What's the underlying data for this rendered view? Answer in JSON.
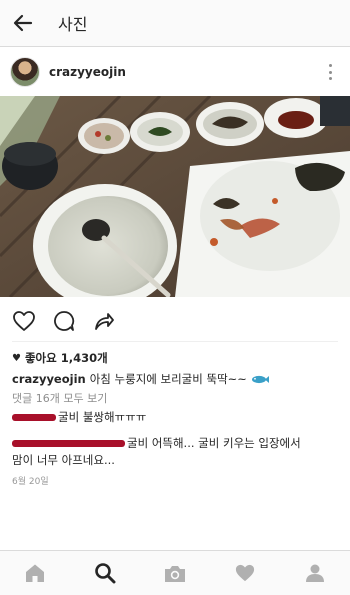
{
  "topbar": {
    "title": "사진"
  },
  "post": {
    "username": "crazyyeojin",
    "likes_text": "좋아요 1,430개",
    "caption": {
      "username": "crazyyeojin",
      "text": "아침 누룽지에 보리굴비 뚝딱~~"
    },
    "view_comments": "댓글 16개 모두 보기",
    "comments": [
      {
        "text": "굴비 불쌍해ㅠㅠㅠ"
      },
      {
        "text": "굴비 어뜩해... 굴비 키우는 입장에서",
        "text2": "맘이 너무 아프네요..."
      }
    ],
    "date": "6월 20일"
  },
  "icons": {
    "back": "arrow-left-icon",
    "more": "more-vertical-icon",
    "like": "heart-outline-icon",
    "comment": "comment-icon",
    "share": "share-arrow-icon",
    "home": "home-icon",
    "search": "search-icon",
    "camera": "camera-icon",
    "activity": "heart-icon",
    "profile": "person-icon"
  },
  "colors": {
    "accent": "#262626",
    "muted": "#8e8e8e",
    "redaction": "#a8102a",
    "fish_emoji": "#3aa0c8"
  }
}
